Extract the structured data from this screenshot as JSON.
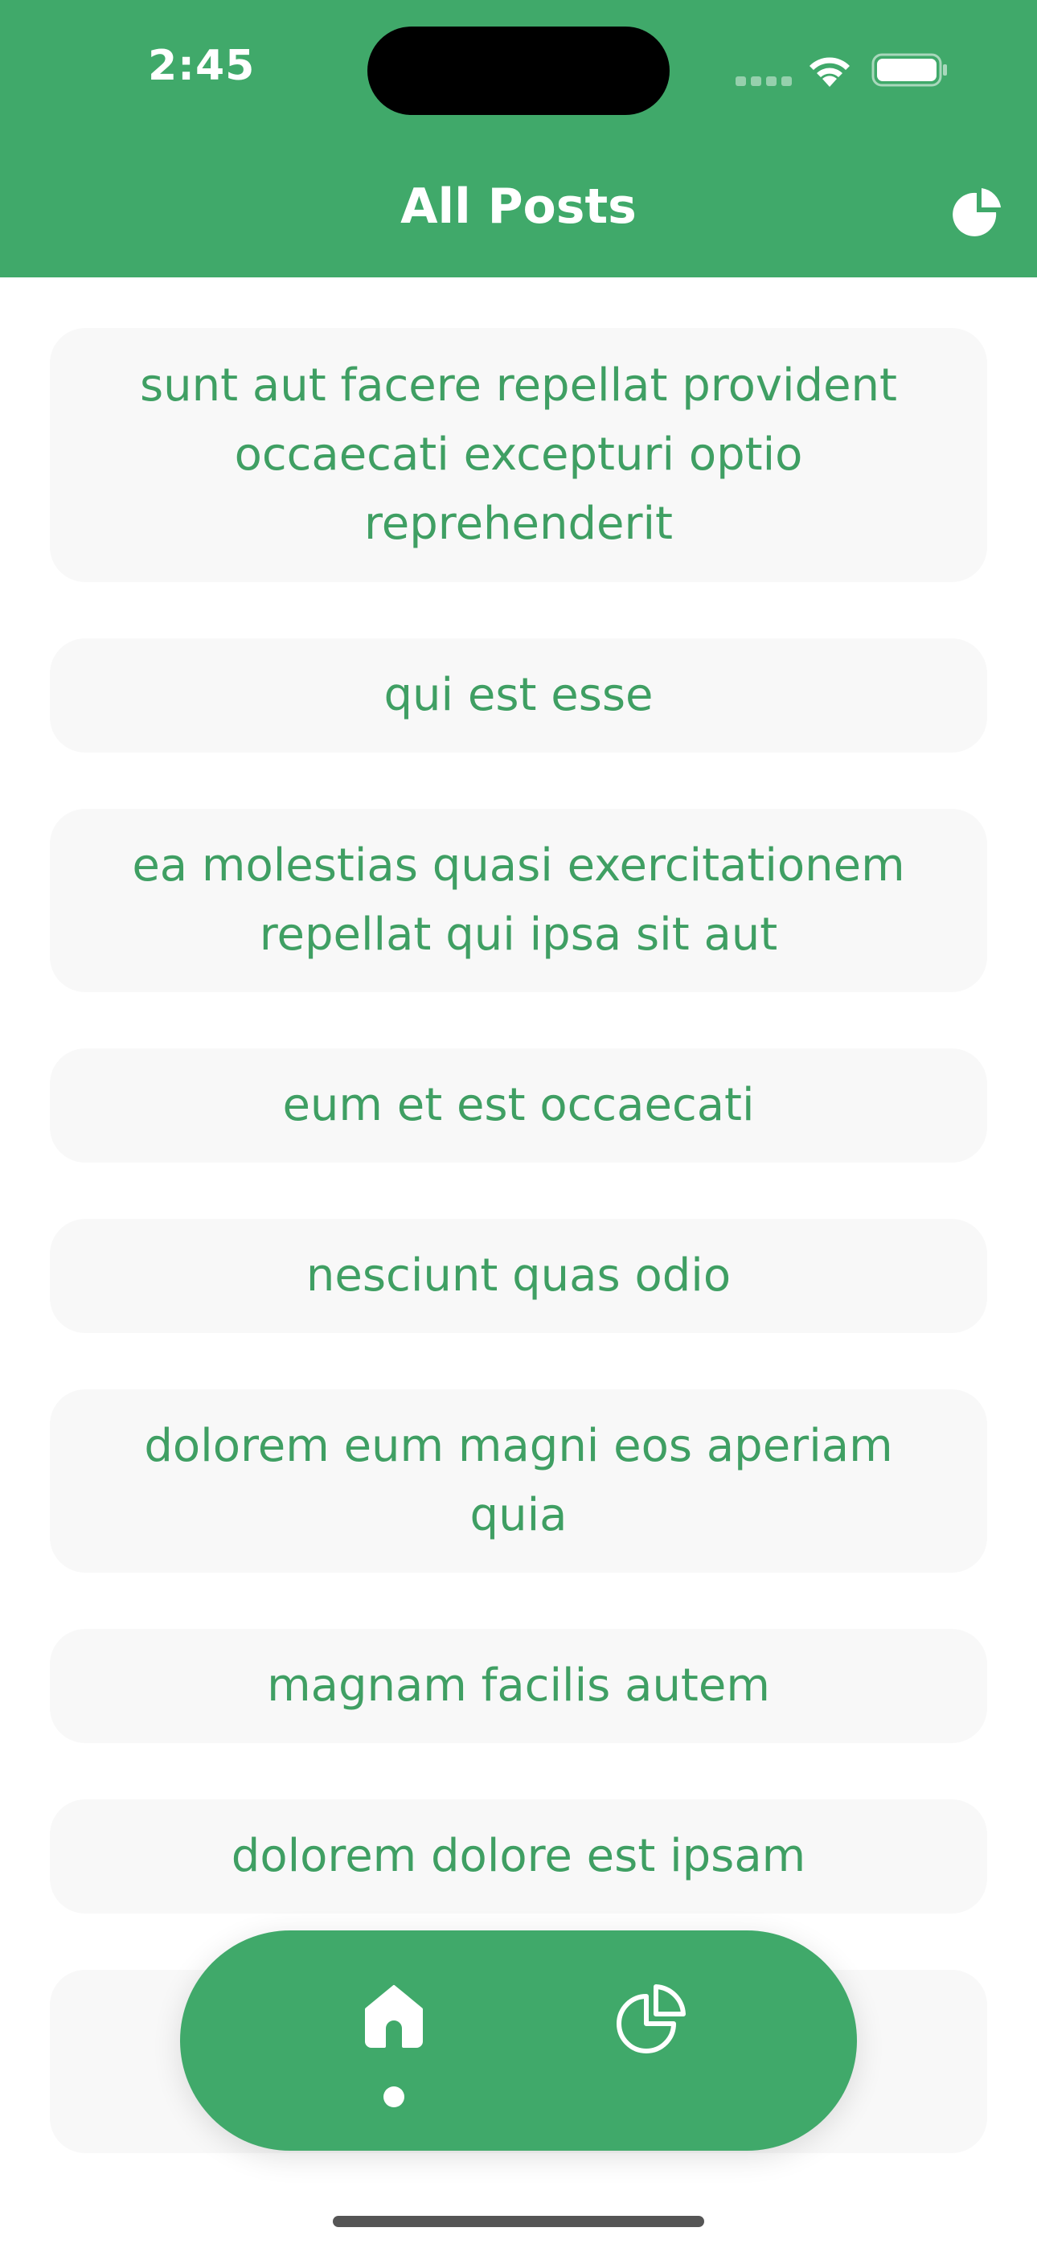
{
  "status_bar": {
    "time": "2:45"
  },
  "header": {
    "title": "All Posts",
    "action_icon": "pie-chart-icon"
  },
  "posts": [
    {
      "title": "sunt aut facere repellat provident occaecati excepturi optio reprehenderit"
    },
    {
      "title": "qui est esse"
    },
    {
      "title": "ea molestias quasi exercitationem repellat qui ipsa sit aut"
    },
    {
      "title": "eum et est occaecati"
    },
    {
      "title": "nesciunt quas odio"
    },
    {
      "title": "dolorem eum magni eos aperiam quia"
    },
    {
      "title": "magnam facilis autem"
    },
    {
      "title": "dolorem dolore est ipsam"
    },
    {
      "title": ""
    }
  ],
  "bottom_nav": {
    "items": [
      {
        "icon": "home-icon",
        "active": true
      },
      {
        "icon": "pie-chart-icon",
        "active": false
      }
    ]
  },
  "colors": {
    "brand_green": "#40a96a",
    "card_text": "#3f9f63",
    "card_background": "#f8f8f8"
  }
}
